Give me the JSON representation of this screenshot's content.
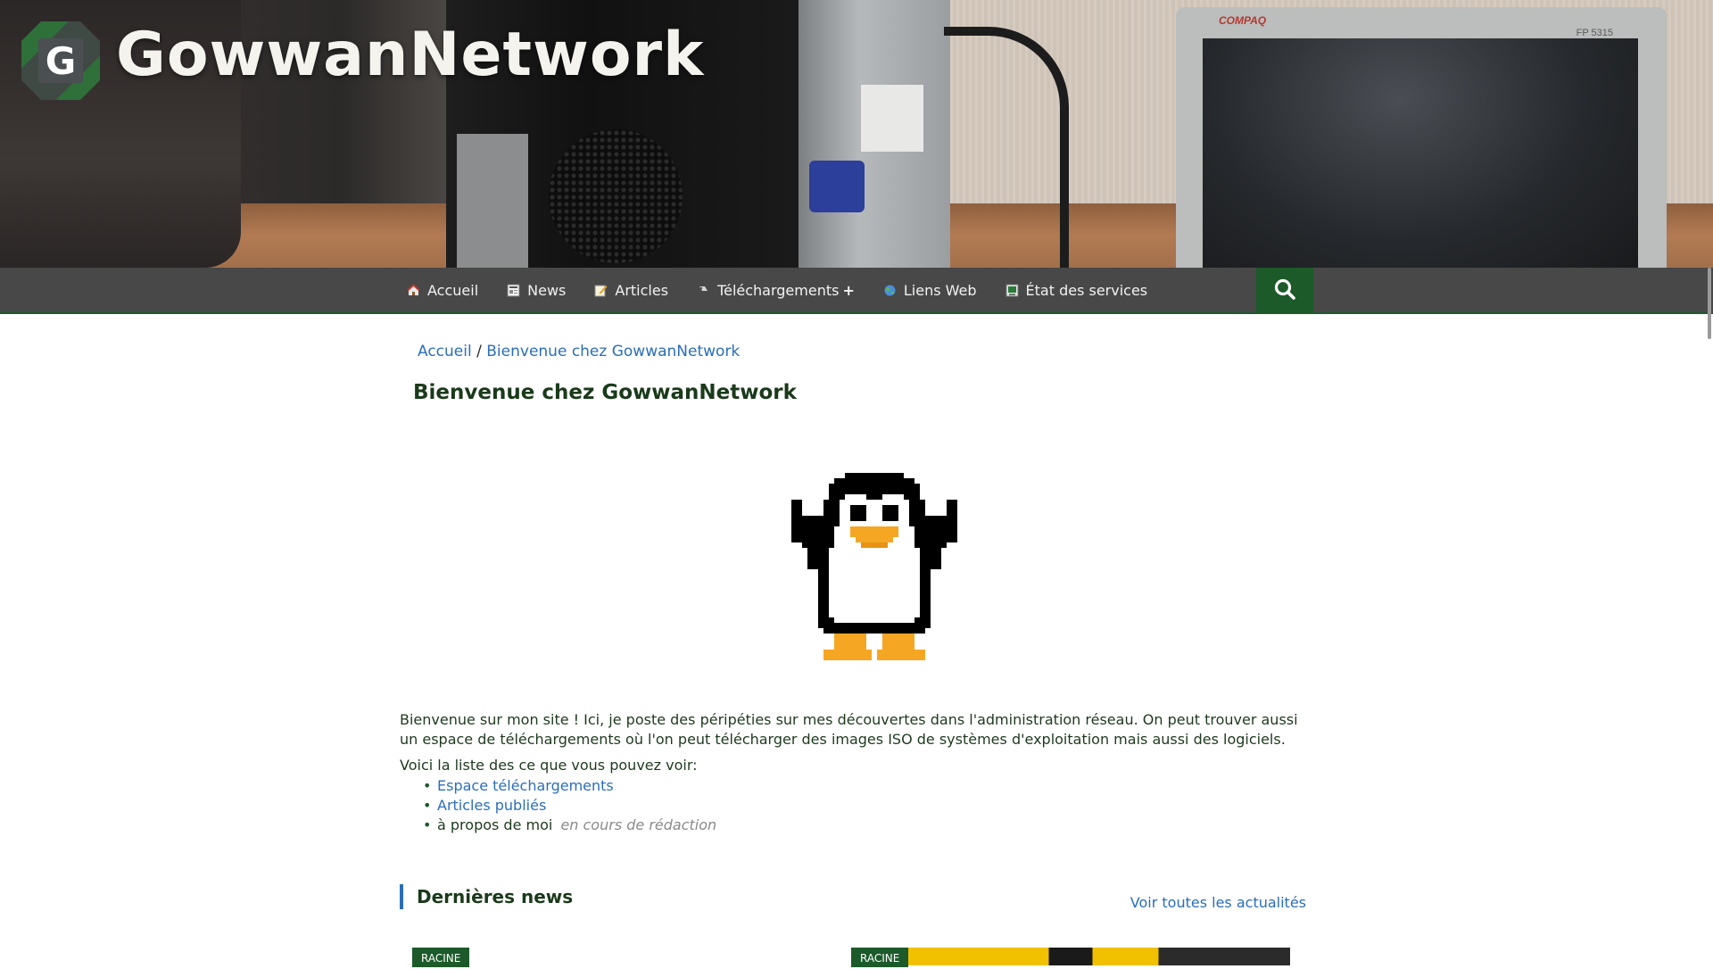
{
  "site": {
    "title": "GowwanNetwork",
    "logo_letter": "G"
  },
  "banner": {
    "monitor_brand": "COMPAQ",
    "monitor_model": "FP 5315"
  },
  "nav": {
    "items": [
      {
        "label": "Accueil",
        "icon": "home-icon"
      },
      {
        "label": "News",
        "icon": "news-icon"
      },
      {
        "label": "Articles",
        "icon": "article-icon"
      },
      {
        "label": "Téléchargements",
        "icon": "download-icon",
        "has_submenu": true,
        "submenu_indicator": "+"
      },
      {
        "label": "Liens Web",
        "icon": "globe-icon"
      },
      {
        "label": "État des services",
        "icon": "status-icon"
      }
    ],
    "search_icon": "search-icon"
  },
  "breadcrumb": {
    "home": "Accueil",
    "separator": "/",
    "current": "Bienvenue chez GowwanNetwork"
  },
  "page": {
    "title": "Bienvenue chez GowwanNetwork",
    "intro": "Bienvenue sur mon site ! Ici, je poste des péripéties sur mes découvertes dans l'administration réseau. On peut trouver aussi un espace de téléchargements où l'on peut télécharger des images ISO de systèmes d'exploitation mais aussi des logiciels.",
    "list_intro": "Voici la liste des ce que vous pouvez voir:",
    "links": [
      {
        "label": "Espace téléchargements"
      },
      {
        "label": "Articles publiés"
      },
      {
        "label": "à propos de moi",
        "note": "en cours de rédaction"
      }
    ]
  },
  "news": {
    "heading": "Dernières news",
    "see_all": "Voir toutes les actualités",
    "cards": [
      {
        "tag": "RACINE"
      },
      {
        "tag": "RACINE"
      }
    ]
  },
  "colors": {
    "accent_green": "#1c5a2a",
    "link_blue": "#2a6ebb",
    "nav_bg": "#3a3a3a"
  }
}
